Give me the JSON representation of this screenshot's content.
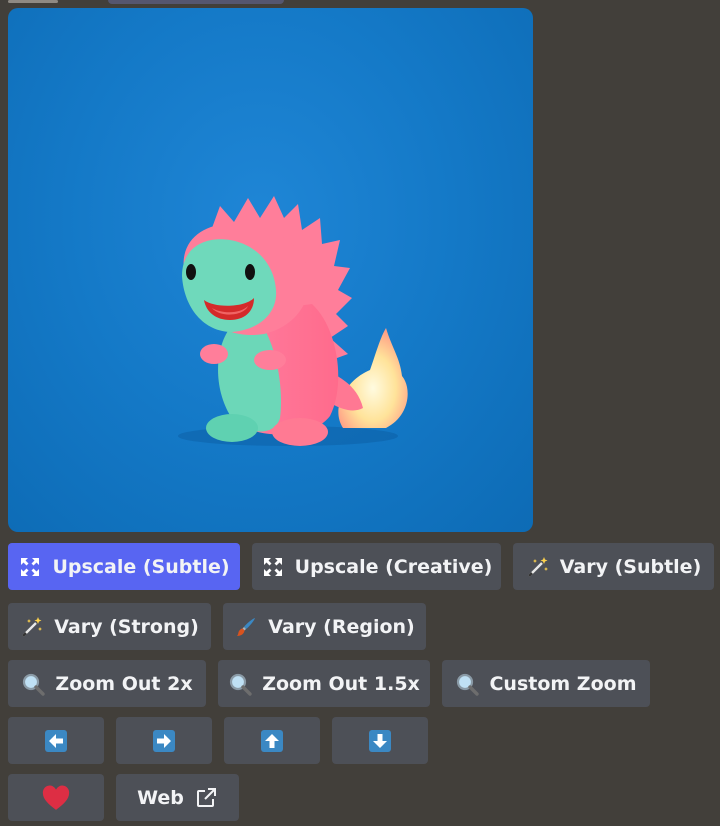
{
  "image": {
    "subject": "pink and green baby dinosaur figurine with fiery tail on blue background"
  },
  "buttons": {
    "upscale_subtle": {
      "label": "Upscale (Subtle)",
      "icon": "expand-arrows-icon"
    },
    "upscale_creative": {
      "label": "Upscale (Creative)",
      "icon": "expand-arrows-icon"
    },
    "vary_subtle": {
      "label": "Vary (Subtle)",
      "icon": "magic-wand-icon"
    },
    "vary_strong": {
      "label": "Vary (Strong)",
      "icon": "magic-wand-icon"
    },
    "vary_region": {
      "label": "Vary (Region)",
      "icon": "paintbrush-icon"
    },
    "zoom_out_2x": {
      "label": "Zoom Out 2x",
      "icon": "magnifier-icon"
    },
    "zoom_out_15x": {
      "label": "Zoom Out 1.5x",
      "icon": "magnifier-icon"
    },
    "custom_zoom": {
      "label": "Custom Zoom",
      "icon": "magnifier-icon"
    },
    "pan_left": {
      "icon": "arrow-left-icon"
    },
    "pan_right": {
      "icon": "arrow-right-icon"
    },
    "pan_up": {
      "icon": "arrow-up-icon"
    },
    "pan_down": {
      "icon": "arrow-down-icon"
    },
    "favorite": {
      "icon": "heart-icon"
    },
    "web": {
      "label": "Web",
      "icon": "external-link-icon"
    }
  },
  "colors": {
    "background": "#423f3a",
    "button": "#4d5057",
    "primary": "#5865f2",
    "arrow_key": "#3b88c3",
    "heart": "#dd2e44"
  }
}
